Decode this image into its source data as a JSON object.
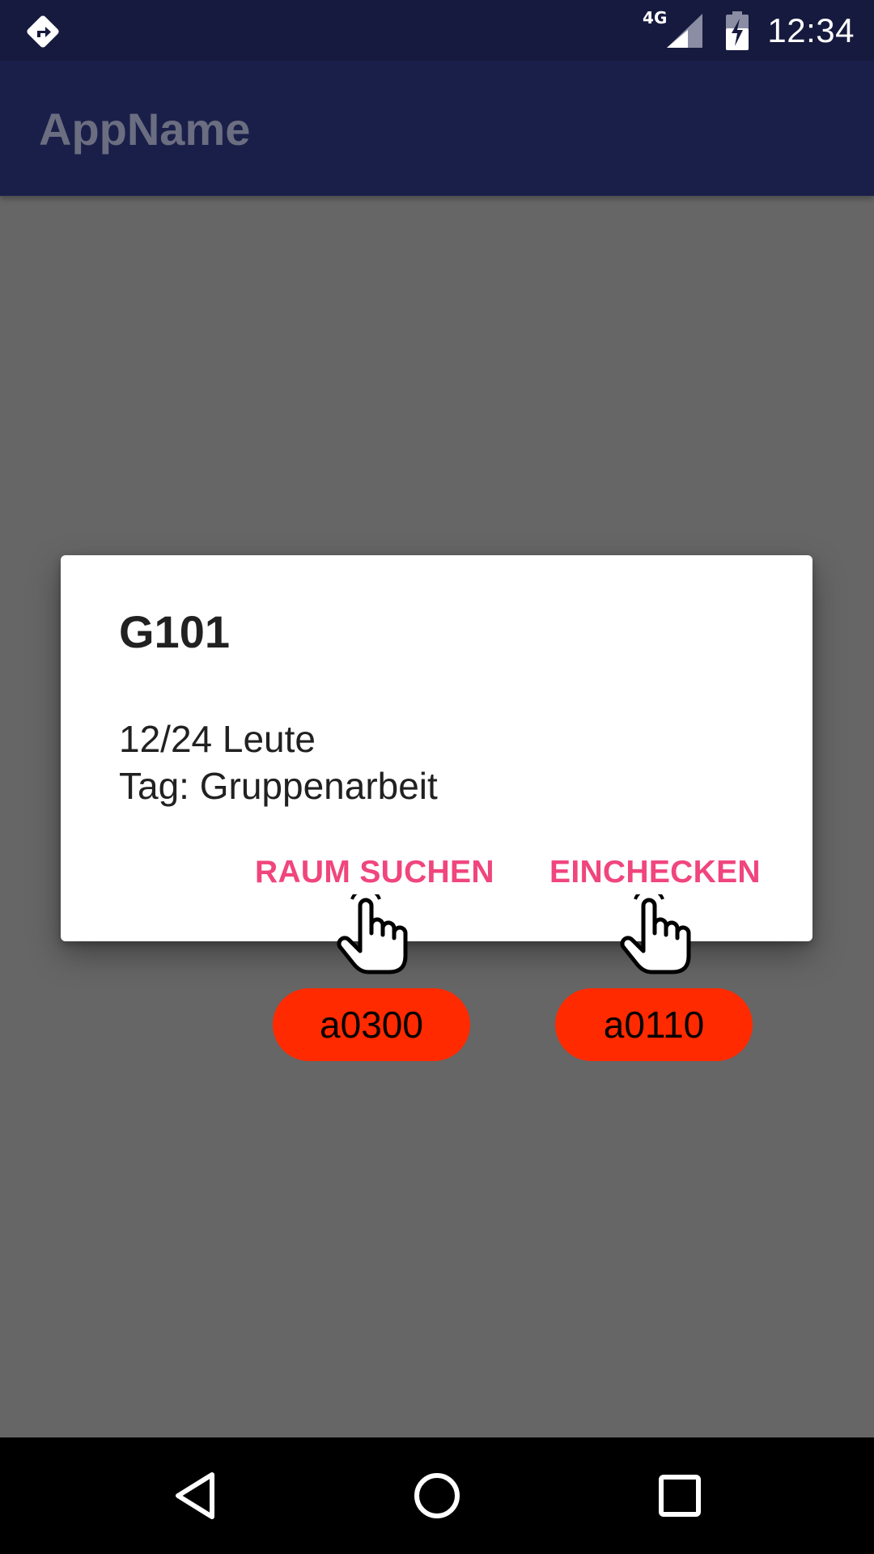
{
  "status_bar": {
    "network": "4G",
    "time": "12:34",
    "left_icon": "navigation-direction-icon",
    "signal_icon": "cell-signal-icon",
    "battery_icon": "battery-charging-icon"
  },
  "app_bar": {
    "title": "AppName"
  },
  "dialog": {
    "title": "G101",
    "message_lines": [
      "12/24 Leute",
      "Tag: Gruppenarbeit"
    ],
    "buttons": {
      "search": "RAUM SUCHEN",
      "checkin": "EINCHECKEN"
    }
  },
  "annotations": [
    {
      "label": "a0300",
      "icon": "pointing-hand-icon"
    },
    {
      "label": "a0110",
      "icon": "pointing-hand-icon"
    }
  ],
  "nav_bar": {
    "back_icon": "back-triangle-icon",
    "home_icon": "home-circle-icon",
    "recents_icon": "recents-square-icon"
  },
  "colors": {
    "status_bar": "#161a3e",
    "app_bar": "#1a1f4a",
    "scrim_background": "#666666",
    "dialog_button_text": "#f0457d",
    "annotation_badge": "#ff2a00"
  }
}
